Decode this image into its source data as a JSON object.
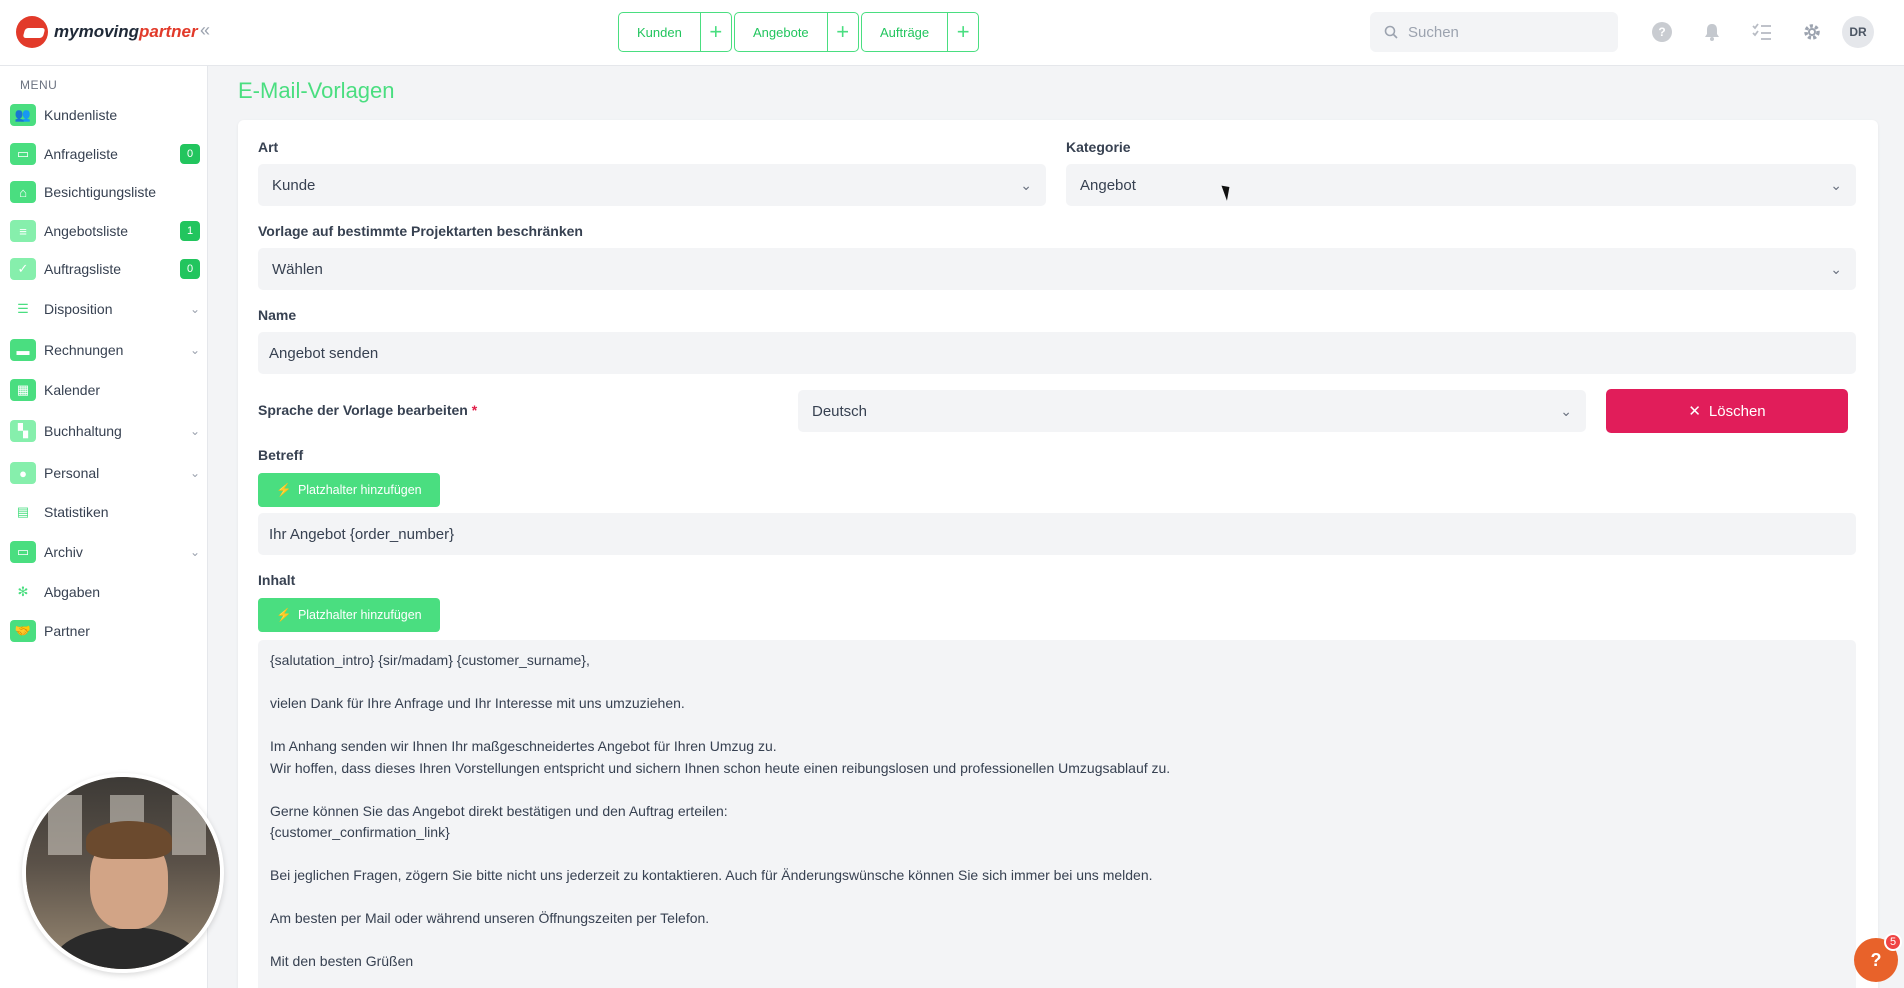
{
  "app": {
    "logo_text_1": "my",
    "logo_text_2": "moving",
    "logo_text_3": "partner",
    "accent_color": "#4ade80",
    "danger_color": "#e11d5a"
  },
  "topbar": {
    "quick_actions": [
      {
        "label": "Kunden",
        "plus": "+"
      },
      {
        "label": "Angebote",
        "plus": "+"
      },
      {
        "label": "Aufträge",
        "plus": "+"
      }
    ],
    "search_placeholder": "Suchen",
    "avatar_initials": "DR"
  },
  "sidebar": {
    "menu_title": "MENU",
    "items": [
      {
        "label": "Kundenliste",
        "icon": "users-icon",
        "badge": ""
      },
      {
        "label": "Anfrageliste",
        "icon": "inbox-icon",
        "badge": "0"
      },
      {
        "label": "Besichtigungsliste",
        "icon": "house-icon",
        "badge": ""
      },
      {
        "label": "Angebotsliste",
        "icon": "document-icon",
        "badge": "1"
      },
      {
        "label": "Auftragsliste",
        "icon": "clipboard-icon",
        "badge": "0"
      },
      {
        "label": "Disposition",
        "icon": "gantt-icon",
        "badge": ""
      },
      {
        "label": "Rechnungen",
        "icon": "money-icon",
        "badge": ""
      },
      {
        "label": "Kalender",
        "icon": "calendar-icon",
        "badge": ""
      },
      {
        "label": "Buchhaltung",
        "icon": "grid-icon",
        "badge": ""
      },
      {
        "label": "Personal",
        "icon": "person-icon",
        "badge": ""
      },
      {
        "label": "Statistiken",
        "icon": "chart-icon",
        "badge": ""
      },
      {
        "label": "Archiv",
        "icon": "archive-icon",
        "badge": ""
      },
      {
        "label": "Abgaben",
        "icon": "network-icon",
        "badge": ""
      },
      {
        "label": "Partner",
        "icon": "handshake-icon",
        "badge": ""
      }
    ]
  },
  "main": {
    "page_title": "E-Mail-Vorlagen",
    "art_label": "Art",
    "art_value": "Kunde",
    "kategorie_label": "Kategorie",
    "kategorie_value": "Angebot",
    "restrict_label": "Vorlage auf bestimmte Projektarten beschränken",
    "restrict_value": "Wählen",
    "name_label": "Name",
    "name_value": "Angebot senden",
    "language_label": "Sprache der Vorlage bearbeiten",
    "required_mark": "*",
    "language_value": "Deutsch",
    "delete_label": "Löschen",
    "betreff_label": "Betreff",
    "placeholder_button": "Platzhalter hinzufügen",
    "betreff_value": "Ihr Angebot {order_number}",
    "inhalt_label": "Inhalt",
    "content_lines": [
      "{salutation_intro} {sir/madam} {customer_surname},",
      "",
      "vielen Dank für Ihre Anfrage und Ihr Interesse mit uns umzuziehen.",
      "",
      "Im Anhang senden wir Ihnen Ihr maßgeschneidertes Angebot für Ihren Umzug zu.",
      "Wir hoffen, dass dieses Ihren Vorstellungen entspricht und sichern Ihnen schon heute einen reibungslosen und professionellen Umzugsablauf zu.",
      "",
      "Gerne können Sie das Angebot direkt bestätigen und den Auftrag erteilen:",
      "{customer_confirmation_link}",
      "",
      "Bei jeglichen Fragen, zögern Sie bitte nicht uns jederzeit zu kontaktieren. Auch für Änderungswünsche können Sie sich immer bei uns melden.",
      "",
      "Am besten per Mail oder während unseren Öffnungszeiten per Telefon.",
      "",
      "Mit den besten Grüßen"
    ]
  },
  "help": {
    "icon": "?",
    "badge": "5"
  }
}
